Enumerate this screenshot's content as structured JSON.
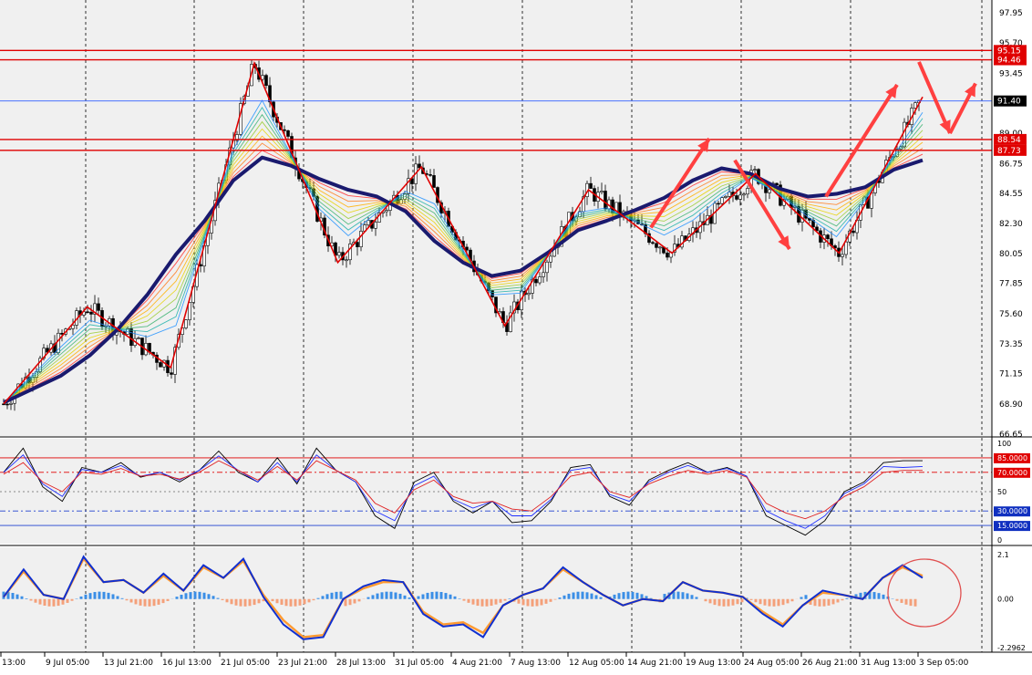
{
  "colors": {
    "background": "#ffffff",
    "panel_bg": "#f0f0f0",
    "grid": "#000000",
    "bull_candle": "#ffffff",
    "bear_candle": "#000000",
    "level_red": "#e00000",
    "level_blue": "#3060ff",
    "zigzag": "#e00000",
    "arrow": "#ff4040",
    "slow_ma": "#1a1a6e",
    "rsi_black": "#000000",
    "rsi_blue": "#2030ff",
    "rsi_red": "#e02020",
    "macd_blue": "#1030d0",
    "macd_orange": "#ff9a30",
    "hist_pos": "#3a8ee6",
    "hist_neg": "#f4a07a",
    "ellipse": "#e05050"
  },
  "chart_data": [
    {
      "type": "candlestick",
      "panel": "price",
      "ylim": [
        66.65,
        97.95
      ],
      "y_ticks": [
        "97.95",
        "95.70",
        "93.45",
        "91.40",
        "89.00",
        "86.75",
        "84.55",
        "82.30",
        "80.05",
        "77.85",
        "75.60",
        "73.35",
        "71.15",
        "68.90",
        "66.65"
      ],
      "price_labels": [
        {
          "value": 95.15,
          "text": "95.15",
          "style": "red"
        },
        {
          "value": 94.46,
          "text": "94.46",
          "style": "red"
        },
        {
          "value": 91.4,
          "text": "91.40",
          "style": "current"
        },
        {
          "value": 88.54,
          "text": "88.54",
          "style": "red"
        },
        {
          "value": 87.73,
          "text": "87.73",
          "style": "red"
        }
      ],
      "horizontal_levels": [
        {
          "value": 95.15,
          "color": "red"
        },
        {
          "value": 94.46,
          "color": "red"
        },
        {
          "value": 91.4,
          "color": "blue"
        },
        {
          "value": 88.54,
          "color": "red"
        },
        {
          "value": 87.73,
          "color": "red"
        }
      ],
      "zigzag_points": [
        68.9,
        76.1,
        71.6,
        94.2,
        79.4,
        86.5,
        74.7,
        84.8,
        80.1,
        86.0,
        80.1,
        91.7
      ],
      "slow_ma_points": [
        69.0,
        70.0,
        71.0,
        72.5,
        74.5,
        77.0,
        80.0,
        82.5,
        85.5,
        87.2,
        86.6,
        85.6,
        84.8,
        84.3,
        83.2,
        81.0,
        79.4,
        78.4,
        78.8,
        80.2,
        81.8,
        82.5,
        83.3,
        84.2,
        85.5,
        86.4,
        86.0,
        84.9,
        84.3,
        84.5,
        85.0,
        86.3,
        87.0
      ],
      "arrows": [
        {
          "from": 82.0,
          "to": 88.6,
          "dir": "up"
        },
        {
          "from": 87.0,
          "to": 80.4,
          "dir": "down"
        },
        {
          "from": 84.3,
          "to": 92.6,
          "dir": "up"
        },
        {
          "from": 94.3,
          "to": 89.0,
          "dir": "down"
        },
        {
          "from": 89.0,
          "to": 92.7,
          "dir": "up"
        }
      ]
    },
    {
      "type": "line",
      "panel": "oscillator",
      "ylim": [
        0,
        100
      ],
      "y_ticks": [
        "100",
        "50",
        "0"
      ],
      "level_labels": [
        {
          "value": 85,
          "text": "85.0000",
          "style": "red"
        },
        {
          "value": 70,
          "text": "70.0000",
          "style": "red"
        },
        {
          "value": 30,
          "text": "30.0000",
          "style": "blue"
        },
        {
          "value": 15,
          "text": "15.0000",
          "style": "blue"
        }
      ],
      "levels": [
        {
          "value": 85,
          "color": "red",
          "dash": "solid"
        },
        {
          "value": 70,
          "color": "red",
          "dash": "dashdot"
        },
        {
          "value": 50,
          "color": "grey",
          "dash": "dot"
        },
        {
          "value": 30,
          "color": "blue",
          "dash": "dashdot"
        },
        {
          "value": 15,
          "color": "blue",
          "dash": "solid"
        }
      ],
      "series": [
        {
          "color": "black",
          "values": [
            70,
            95,
            55,
            40,
            75,
            70,
            80,
            65,
            70,
            60,
            72,
            92,
            70,
            60,
            85,
            58,
            95,
            72,
            60,
            25,
            12,
            60,
            70,
            40,
            28,
            40,
            18,
            20,
            40,
            75,
            78,
            45,
            36,
            62,
            72,
            80,
            70,
            75,
            66,
            25,
            15,
            5,
            20,
            50,
            60,
            80,
            82,
            82
          ]
        },
        {
          "color": "blue",
          "values": [
            70,
            88,
            58,
            45,
            73,
            70,
            77,
            66,
            70,
            62,
            72,
            87,
            72,
            60,
            80,
            60,
            88,
            72,
            60,
            30,
            20,
            56,
            66,
            42,
            33,
            40,
            25,
            25,
            42,
            72,
            75,
            47,
            40,
            60,
            70,
            77,
            70,
            74,
            66,
            30,
            20,
            12,
            25,
            48,
            58,
            76,
            75,
            76
          ]
        },
        {
          "color": "red",
          "values": [
            68,
            80,
            60,
            50,
            70,
            68,
            74,
            66,
            68,
            63,
            70,
            82,
            72,
            62,
            76,
            62,
            82,
            72,
            62,
            38,
            28,
            52,
            62,
            45,
            38,
            40,
            32,
            30,
            45,
            66,
            70,
            50,
            44,
            58,
            66,
            72,
            68,
            72,
            65,
            38,
            28,
            22,
            30,
            45,
            55,
            70,
            72,
            72
          ]
        }
      ]
    },
    {
      "type": "bar",
      "panel": "macd",
      "ylim": [
        -2.2962,
        2.1
      ],
      "y_ticks": [
        "2.1",
        "0.00",
        "-2.2962"
      ],
      "series": [
        {
          "name": "",
          "color": "blue",
          "values": [
            0.1,
            1.4,
            0.2,
            0.0,
            2.0,
            0.8,
            0.9,
            0.3,
            1.2,
            0.4,
            1.6,
            1.0,
            1.9,
            0.1,
            -1.2,
            -1.9,
            -1.8,
            0.0,
            0.6,
            0.9,
            0.8,
            -0.7,
            -1.3,
            -1.2,
            -1.8,
            -0.3,
            0.2,
            0.5,
            1.5,
            0.8,
            0.2,
            -0.3,
            0.0,
            -0.1,
            0.8,
            0.4,
            0.3,
            0.1,
            -0.7,
            -1.3,
            -0.3,
            0.4,
            0.2,
            0.0,
            1.0,
            1.6,
            1.0
          ]
        },
        {
          "name": "",
          "color": "orange",
          "values": [
            0.1,
            1.3,
            0.2,
            0.0,
            1.9,
            0.8,
            0.9,
            0.3,
            1.1,
            0.4,
            1.5,
            1.0,
            1.8,
            0.2,
            -1.0,
            -1.8,
            -1.7,
            0.0,
            0.5,
            0.8,
            0.8,
            -0.6,
            -1.2,
            -1.1,
            -1.6,
            -0.3,
            0.2,
            0.5,
            1.4,
            0.8,
            0.2,
            -0.3,
            0.0,
            -0.1,
            0.8,
            0.4,
            0.3,
            0.1,
            -0.6,
            -1.2,
            -0.3,
            0.3,
            0.2,
            0.0,
            1.0,
            1.5,
            1.1
          ]
        }
      ]
    }
  ],
  "x_labels": [
    "13:00",
    "9 Jul 05:00",
    "13 Jul 21:00",
    "16 Jul 13:00",
    "21 Jul 05:00",
    "23 Jul 21:00",
    "28 Jul 13:00",
    "31 Jul 05:00",
    "4 Aug 21:00",
    "7 Aug 13:00",
    "12 Aug 05:00",
    "14 Aug 21:00",
    "19 Aug 13:00",
    "24 Aug 05:00",
    "26 Aug 21:00",
    "31 Aug 13:00",
    "3 Sep 05:00"
  ]
}
